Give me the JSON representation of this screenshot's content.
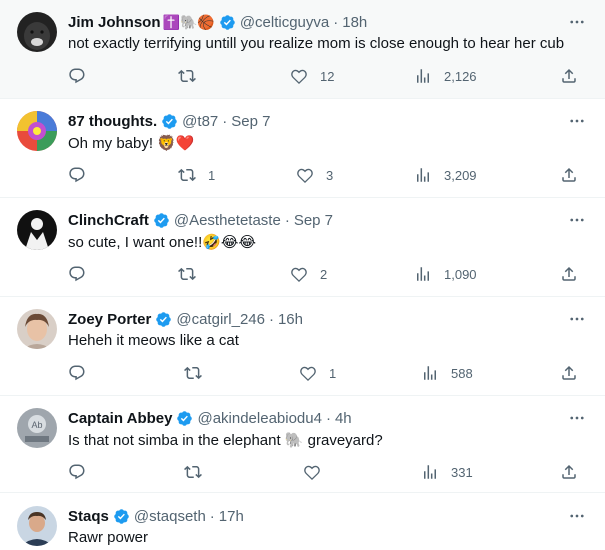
{
  "colors": {
    "text": "#0f1419",
    "secondary": "#536471",
    "verified": "#1d9bf0",
    "separator": "#eff3f4",
    "hover_bg": "#f7f9f9"
  },
  "icons": {
    "reply": "reply-icon",
    "retweet": "retweet-icon",
    "like": "heart-icon",
    "views": "views-icon",
    "share": "share-icon",
    "more": "more-icon",
    "verified": "verified-badge-icon"
  },
  "tweets": [
    {
      "name": "Jim Johnson",
      "name_emojis": "✝️🐘🏀",
      "verified": true,
      "handle": "@celticguyva",
      "time": "18h",
      "text": "not exactly terrifying untill you realize mom is close enough to hear her cub",
      "replies": "",
      "retweets": "",
      "likes": "12",
      "views": "2,126"
    },
    {
      "name": "87 thoughts.",
      "name_emojis": "",
      "verified": true,
      "handle": "@t87",
      "time": "Sep 7",
      "text": "Oh my baby! 🦁❤️",
      "replies": "",
      "retweets": "1",
      "likes": "3",
      "views": "3,209"
    },
    {
      "name": "ClinchCraft",
      "name_emojis": "",
      "verified": true,
      "handle": "@Aesthetetaste",
      "time": "Sep 7",
      "text": "so cute, I want one!!🤣😂😂",
      "replies": "",
      "retweets": "",
      "likes": "2",
      "views": "1,090"
    },
    {
      "name": "Zoey Porter",
      "name_emojis": "",
      "verified": true,
      "handle": "@catgirl_246",
      "time": "16h",
      "text": "Heheh it meows like a cat",
      "replies": "",
      "retweets": "",
      "likes": "1",
      "views": "588"
    },
    {
      "name": "Captain Abbey",
      "name_emojis": "",
      "verified": true,
      "handle": "@akindeleabiodu4",
      "time": "4h",
      "text": "Is that not simba in the elephant 🐘 graveyard?",
      "replies": "",
      "retweets": "",
      "likes": "",
      "views": "331"
    },
    {
      "name": "Staqs",
      "name_emojis": "",
      "verified": true,
      "handle": "@staqseth",
      "time": "17h",
      "text": "Rawr power",
      "replies": "",
      "retweets": "",
      "likes": "",
      "views": ""
    }
  ]
}
